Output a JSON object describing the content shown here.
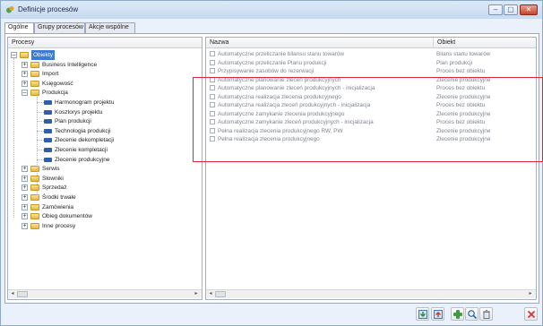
{
  "window": {
    "title": "Definicje procesów",
    "minimize_glyph": "–",
    "maximize_glyph": "▢",
    "close_glyph": "✕"
  },
  "tabs": [
    {
      "label": "Ogólne",
      "active": true
    },
    {
      "label": "Grupy procesów",
      "active": false
    },
    {
      "label": "Akcje wspólne",
      "active": false
    }
  ],
  "tree": {
    "header": "Procesy",
    "items": [
      {
        "label": "Obiekty",
        "icon": "folder-icon",
        "expander": "–",
        "selected": true
      },
      {
        "label": "Business Intelligence",
        "icon": "folder-icon",
        "expander": "+"
      },
      {
        "label": "Import",
        "icon": "folder-icon",
        "expander": "+"
      },
      {
        "label": "Księgowość",
        "icon": "folder-icon",
        "expander": "+"
      },
      {
        "label": "Produkcja",
        "icon": "folder-icon",
        "expander": "–"
      },
      {
        "label": "Harmonogram projektu",
        "icon": "process-icon"
      },
      {
        "label": "Kosztorys projektu",
        "icon": "process-icon"
      },
      {
        "label": "Plan produkcji",
        "icon": "process-icon"
      },
      {
        "label": "Technologia produkcji",
        "icon": "process-icon"
      },
      {
        "label": "Zlecenie dekompletacji",
        "icon": "process-icon"
      },
      {
        "label": "Zlecenie kompletacji",
        "icon": "process-icon"
      },
      {
        "label": "Zlecenie produkcyjne",
        "icon": "process-icon"
      },
      {
        "label": "Serwis",
        "icon": "folder-icon",
        "expander": "+"
      },
      {
        "label": "Słowniki",
        "icon": "folder-icon",
        "expander": "+"
      },
      {
        "label": "Sprzedaż",
        "icon": "folder-icon",
        "expander": "+"
      },
      {
        "label": "Środki trwałe",
        "icon": "folder-icon",
        "expander": "+"
      },
      {
        "label": "Zamówienia",
        "icon": "folder-icon",
        "expander": "+"
      },
      {
        "label": "Obieg dokumentów",
        "icon": "folder-icon",
        "expander": "+"
      },
      {
        "label": "Inne procesy",
        "icon": "folder-icon",
        "expander": "+"
      }
    ]
  },
  "list": {
    "columns": {
      "name": "Nazwa",
      "object": "Obiekt"
    },
    "rows": [
      {
        "name": "Automatyczne przeliczanie bilansu stanu towarów",
        "object": "Bilans stanu towarów"
      },
      {
        "name": "Automatyczne przeliczanie Planu produkcji",
        "object": "Plan produkcji"
      },
      {
        "name": "Przypisywanie zasobów do rezerwacji",
        "object": "Proces bez obiektu"
      },
      {
        "name": "Automatyczne planowanie zleceń produkcyjnych",
        "object": "Zlecenie produkcyjne"
      },
      {
        "name": "Automatyczne planowanie zleceń produkcyjnych - inicjalizacja",
        "object": "Proces bez obiektu"
      },
      {
        "name": "Automatyczna realizacja zlecenia produkcyjnego",
        "object": "Zlecenie produkcyjne"
      },
      {
        "name": "Automatyczna realizacja zleceń produkcyjnych - inicjalizacja",
        "object": "Proces bez obiektu"
      },
      {
        "name": "Automatyczne zamykanie zlecenia produkcyjnego",
        "object": "Zlecenie produkcyjne"
      },
      {
        "name": "Automatyczne zamykanie zleceń produkcyjnych - inicjalizacja",
        "object": "Proces bez obiektu"
      },
      {
        "name": "Pełna realizacja zlecenia produkcyjnego RW, PW",
        "object": "Zlecenie produkcyjne"
      },
      {
        "name": "Pełna realizacja zlecenia produkcyjnego",
        "object": "Zlecenie produkcyjne"
      }
    ]
  },
  "toolbar": [
    {
      "name": "import-button",
      "icon": "import-icon"
    },
    {
      "name": "export-button",
      "icon": "export-icon"
    },
    {
      "name": "add-button",
      "icon": "plus-icon"
    },
    {
      "name": "edit-button",
      "icon": "magnifier-icon"
    },
    {
      "name": "delete-button",
      "icon": "trash-icon"
    },
    {
      "name": "close-button",
      "icon": "close-icon"
    }
  ],
  "colors": {
    "selection": "#3a7bd5",
    "highlight_frame": "#e0243a",
    "add_green": "#3aa13a",
    "close_red": "#d9352b"
  }
}
